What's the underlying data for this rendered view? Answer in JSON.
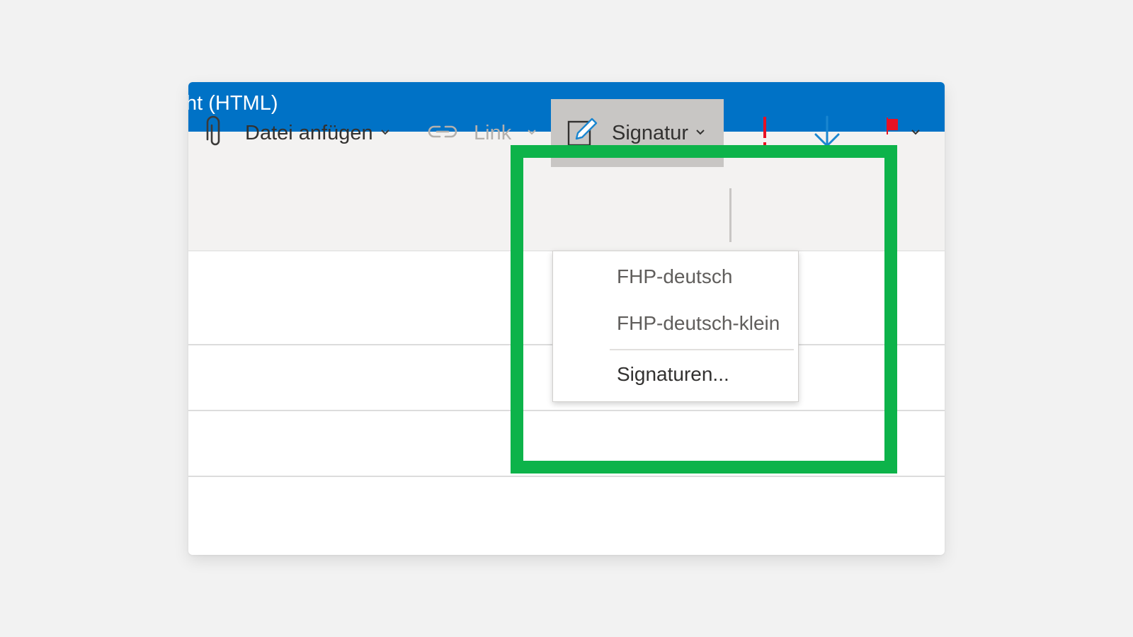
{
  "window": {
    "title": "ht (HTML)"
  },
  "toolbar": {
    "attach": {
      "label": "Datei anfügen",
      "icon": "paperclip-icon"
    },
    "link": {
      "label": "Link",
      "icon": "link-icon"
    },
    "signature": {
      "label": "Signatur",
      "icon": "signature-pen-icon"
    },
    "importance_high": {
      "icon": "exclamation-icon"
    },
    "importance_low": {
      "icon": "arrow-down-icon"
    },
    "flag": {
      "icon": "flag-icon"
    }
  },
  "signature_menu": {
    "items": [
      "FHP-deutsch",
      "FHP-deutsch-klein"
    ],
    "manage_label": "Signaturen..."
  },
  "colors": {
    "titlebar": "#0072c6",
    "highlight": "#0db34a",
    "accent_blue": "#1a86d0",
    "important_red": "#e81123"
  }
}
